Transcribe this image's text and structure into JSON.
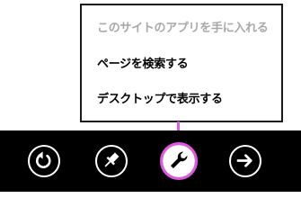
{
  "menu": {
    "items": [
      {
        "label": "このサイトのアプリを手に入れる",
        "enabled": false
      },
      {
        "label": "ページを検索する",
        "enabled": true
      },
      {
        "label": "デスクトップで表示する",
        "enabled": true
      }
    ]
  },
  "appbar": {
    "buttons": [
      {
        "icon": "refresh-icon"
      },
      {
        "icon": "pin-icon"
      },
      {
        "icon": "wrench-icon",
        "active": true
      },
      {
        "icon": "forward-arrow-icon"
      }
    ]
  },
  "colors": {
    "highlight": "#e455e4",
    "appbar_bg": "#000000",
    "disabled_text": "#a8a8a8"
  }
}
